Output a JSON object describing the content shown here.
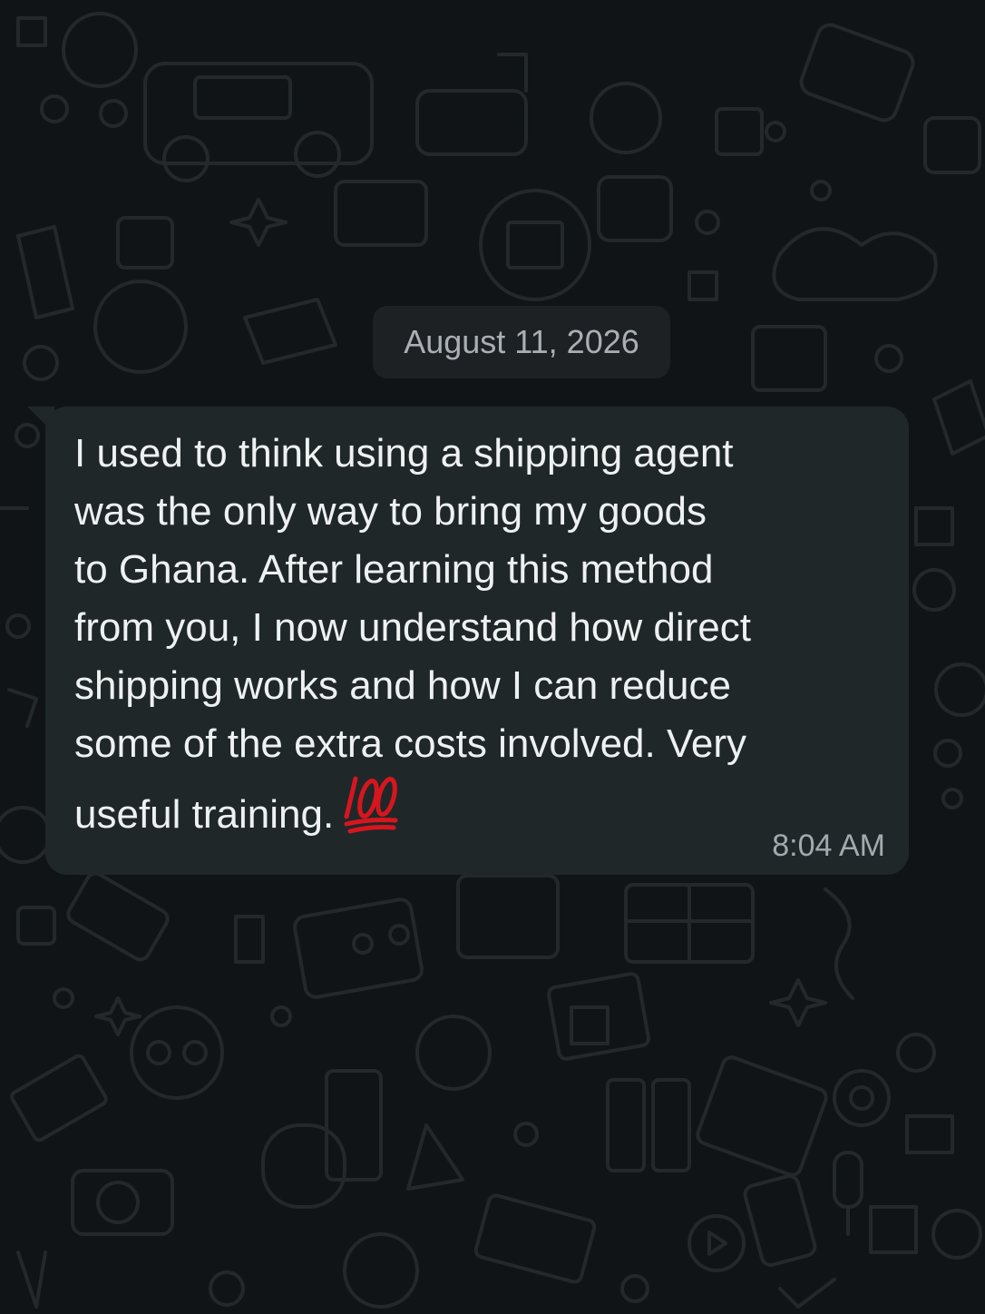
{
  "chat": {
    "date_separator": "August 11, 2026",
    "messages": [
      {
        "text": "I used to think using a shipping agent\nwas the only way to bring my goods\nto Ghana. After learning this method\nfrom you, I now understand how direct\nshipping works and how I can reduce\nsome of the extra costs involved. Very\nuseful training.",
        "emoji": "hundred-points-icon",
        "time": "8:04 AM",
        "direction": "incoming"
      }
    ]
  },
  "colors": {
    "background": "#111416",
    "bubble": "#202729",
    "date_pill": "#1d2124",
    "text": "#eef1f2",
    "muted_text": "#a9b0b4",
    "emoji_red": "#d6161f"
  }
}
